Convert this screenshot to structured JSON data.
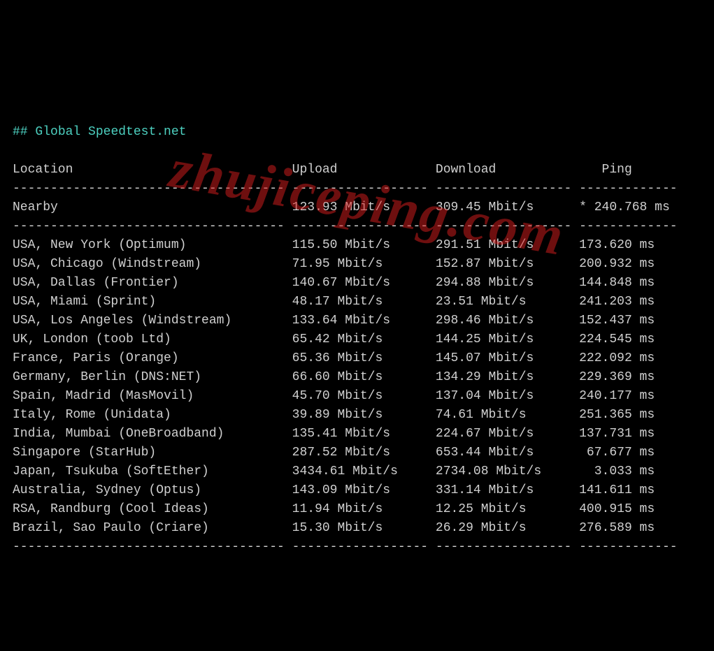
{
  "header": {
    "hash": "##",
    "title": "Global Speedtest.net"
  },
  "columns": {
    "location": "Location",
    "upload": "Upload",
    "download": "Download",
    "ping": "Ping"
  },
  "nearby": {
    "location": "Nearby",
    "upload": "123.93 Mbit/s",
    "download": "309.45 Mbit/s",
    "ping": "* 240.768 ms"
  },
  "rows": [
    {
      "location": "USA, New York (Optimum)",
      "upload": "115.50 Mbit/s",
      "download": "291.51 Mbit/s",
      "ping": "173.620 ms"
    },
    {
      "location": "USA, Chicago (Windstream)",
      "upload": "71.95 Mbit/s",
      "download": "152.87 Mbit/s",
      "ping": "200.932 ms"
    },
    {
      "location": "USA, Dallas (Frontier)",
      "upload": "140.67 Mbit/s",
      "download": "294.88 Mbit/s",
      "ping": "144.848 ms"
    },
    {
      "location": "USA, Miami (Sprint)",
      "upload": "48.17 Mbit/s",
      "download": "23.51 Mbit/s",
      "ping": "241.203 ms"
    },
    {
      "location": "USA, Los Angeles (Windstream)",
      "upload": "133.64 Mbit/s",
      "download": "298.46 Mbit/s",
      "ping": "152.437 ms"
    },
    {
      "location": "UK, London (toob Ltd)",
      "upload": "65.42 Mbit/s",
      "download": "144.25 Mbit/s",
      "ping": "224.545 ms"
    },
    {
      "location": "France, Paris (Orange)",
      "upload": "65.36 Mbit/s",
      "download": "145.07 Mbit/s",
      "ping": "222.092 ms"
    },
    {
      "location": "Germany, Berlin (DNS:NET)",
      "upload": "66.60 Mbit/s",
      "download": "134.29 Mbit/s",
      "ping": "229.369 ms"
    },
    {
      "location": "Spain, Madrid (MasMovil)",
      "upload": "45.70 Mbit/s",
      "download": "137.04 Mbit/s",
      "ping": "240.177 ms"
    },
    {
      "location": "Italy, Rome (Unidata)",
      "upload": "39.89 Mbit/s",
      "download": "74.61 Mbit/s",
      "ping": "251.365 ms"
    },
    {
      "location": "India, Mumbai (OneBroadband)",
      "upload": "135.41 Mbit/s",
      "download": "224.67 Mbit/s",
      "ping": "137.731 ms"
    },
    {
      "location": "Singapore (StarHub)",
      "upload": "287.52 Mbit/s",
      "download": "653.44 Mbit/s",
      "ping": "67.677 ms"
    },
    {
      "location": "Japan, Tsukuba (SoftEther)",
      "upload": "3434.61 Mbit/s",
      "download": "2734.08 Mbit/s",
      "ping": "3.033 ms"
    },
    {
      "location": "Australia, Sydney (Optus)",
      "upload": "143.09 Mbit/s",
      "download": "331.14 Mbit/s",
      "ping": "141.611 ms"
    },
    {
      "location": "RSA, Randburg (Cool Ideas)",
      "upload": "11.94 Mbit/s",
      "download": "12.25 Mbit/s",
      "ping": "400.915 ms"
    },
    {
      "location": "Brazil, Sao Paulo (Criare)",
      "upload": "15.30 Mbit/s",
      "download": "26.29 Mbit/s",
      "ping": "276.589 ms"
    }
  ],
  "watermark": "zhujiceping.com",
  "chart_data": {
    "type": "table",
    "title": "Global Speedtest.net",
    "columns": [
      "Location",
      "Upload",
      "Download",
      "Ping"
    ],
    "rows": [
      [
        "Nearby",
        "123.93 Mbit/s",
        "309.45 Mbit/s",
        "* 240.768 ms"
      ],
      [
        "USA, New York (Optimum)",
        "115.50 Mbit/s",
        "291.51 Mbit/s",
        "173.620 ms"
      ],
      [
        "USA, Chicago (Windstream)",
        "71.95 Mbit/s",
        "152.87 Mbit/s",
        "200.932 ms"
      ],
      [
        "USA, Dallas (Frontier)",
        "140.67 Mbit/s",
        "294.88 Mbit/s",
        "144.848 ms"
      ],
      [
        "USA, Miami (Sprint)",
        "48.17 Mbit/s",
        "23.51 Mbit/s",
        "241.203 ms"
      ],
      [
        "USA, Los Angeles (Windstream)",
        "133.64 Mbit/s",
        "298.46 Mbit/s",
        "152.437 ms"
      ],
      [
        "UK, London (toob Ltd)",
        "65.42 Mbit/s",
        "144.25 Mbit/s",
        "224.545 ms"
      ],
      [
        "France, Paris (Orange)",
        "65.36 Mbit/s",
        "145.07 Mbit/s",
        "222.092 ms"
      ],
      [
        "Germany, Berlin (DNS:NET)",
        "66.60 Mbit/s",
        "134.29 Mbit/s",
        "229.369 ms"
      ],
      [
        "Spain, Madrid (MasMovil)",
        "45.70 Mbit/s",
        "137.04 Mbit/s",
        "240.177 ms"
      ],
      [
        "Italy, Rome (Unidata)",
        "39.89 Mbit/s",
        "74.61 Mbit/s",
        "251.365 ms"
      ],
      [
        "India, Mumbai (OneBroadband)",
        "135.41 Mbit/s",
        "224.67 Mbit/s",
        "137.731 ms"
      ],
      [
        "Singapore (StarHub)",
        "287.52 Mbit/s",
        "653.44 Mbit/s",
        "67.677 ms"
      ],
      [
        "Japan, Tsukuba (SoftEther)",
        "3434.61 Mbit/s",
        "2734.08 Mbit/s",
        "3.033 ms"
      ],
      [
        "Australia, Sydney (Optus)",
        "143.09 Mbit/s",
        "331.14 Mbit/s",
        "141.611 ms"
      ],
      [
        "RSA, Randburg (Cool Ideas)",
        "11.94 Mbit/s",
        "12.25 Mbit/s",
        "400.915 ms"
      ],
      [
        "Brazil, Sao Paulo (Criare)",
        "15.30 Mbit/s",
        "26.29 Mbit/s",
        "276.589 ms"
      ]
    ]
  }
}
